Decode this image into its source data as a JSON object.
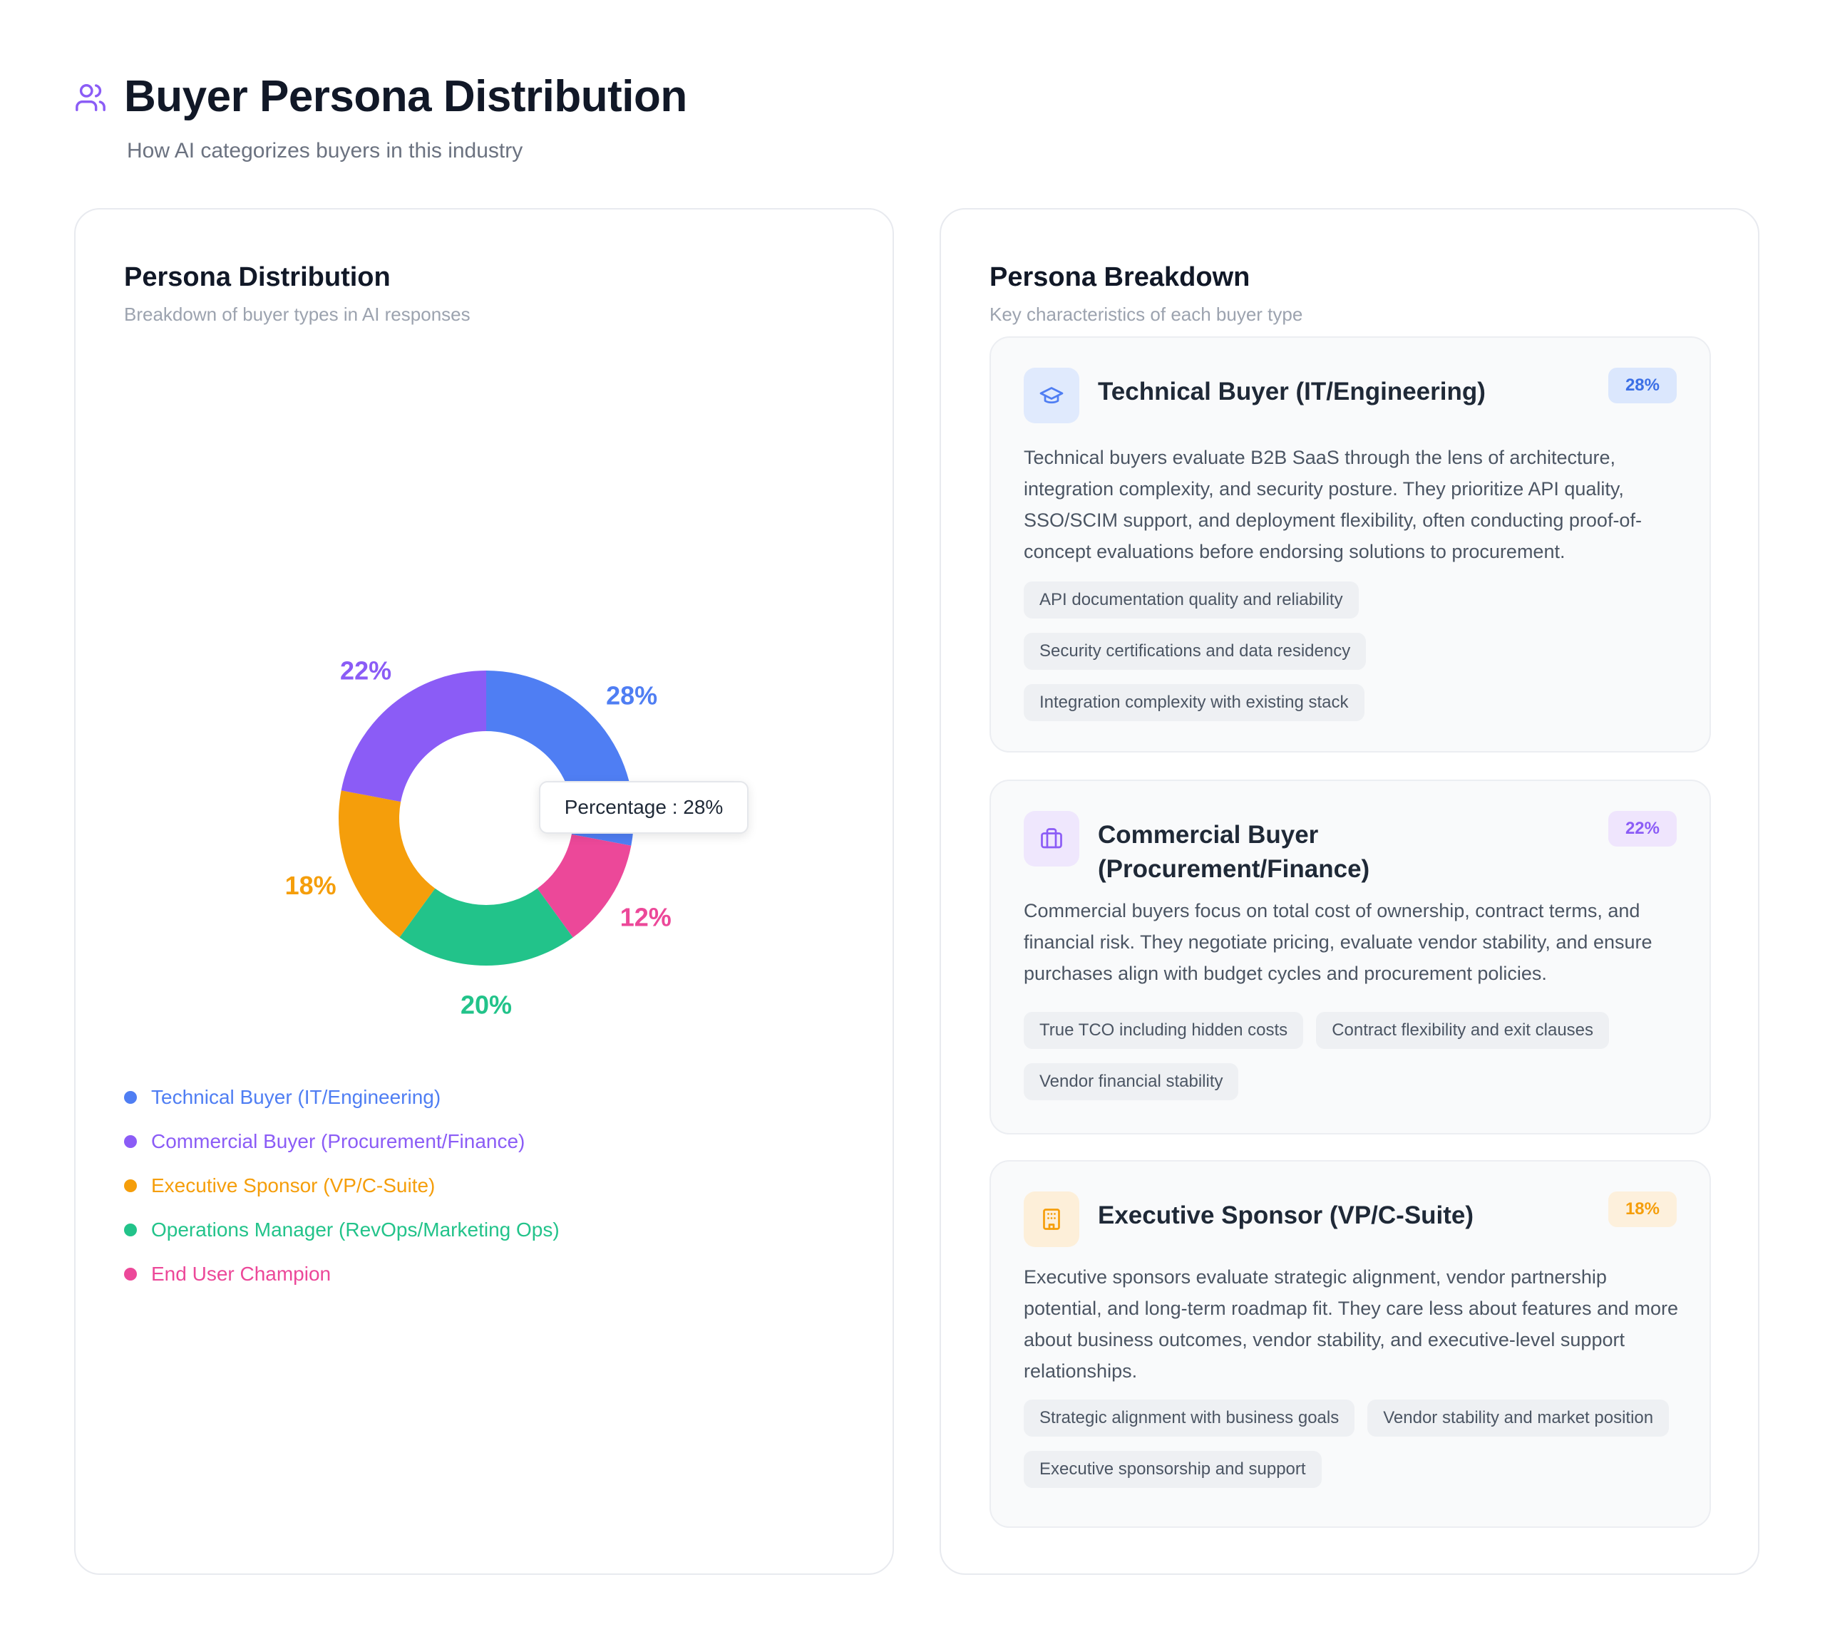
{
  "header": {
    "title": "Buyer Persona Distribution",
    "subtitle": "How AI categorizes buyers in this industry",
    "icon": "users-icon"
  },
  "left_card": {
    "title": "Persona Distribution",
    "subtitle": "Breakdown of buyer types in AI responses",
    "tooltip": "Percentage : 28%"
  },
  "chart_data": {
    "type": "pie",
    "donut": true,
    "categories": [
      "Technical Buyer (IT/Engineering)",
      "End User Champion",
      "Operations Manager (RevOps/Marketing Ops)",
      "Executive Sponsor (VP/C-Suite)",
      "Commercial Buyer (Procurement/Finance)"
    ],
    "values": [
      28,
      12,
      20,
      18,
      22
    ],
    "data_labels": [
      "28%",
      "12%",
      "20%",
      "18%",
      "22%"
    ],
    "colors": [
      "#4f7ef3",
      "#ec4899",
      "#22c38a",
      "#f59e0b",
      "#8b5cf6"
    ],
    "legend_position": "bottom-left"
  },
  "legend": [
    {
      "label": "Technical Buyer (IT/Engineering)",
      "color": "#4f7ef3"
    },
    {
      "label": "Commercial Buyer (Procurement/Finance)",
      "color": "#8b5cf6"
    },
    {
      "label": "Executive Sponsor (VP/C-Suite)",
      "color": "#f59e0b"
    },
    {
      "label": "Operations Manager (RevOps/Marketing Ops)",
      "color": "#22c38a"
    },
    {
      "label": "End User Champion",
      "color": "#ec4899"
    }
  ],
  "right_card": {
    "title": "Persona Breakdown",
    "subtitle": "Key characteristics of each buyer type",
    "personas": [
      {
        "title": "Technical Buyer (IT/Engineering)",
        "badge": "28%",
        "icon": "graduation-cap-icon",
        "accent": "#4f7ef3",
        "description": "Technical buyers evaluate B2B SaaS through the lens of architecture, integration complexity, and security posture. They prioritize API quality, SSO/SCIM support, and deployment flexibility, often conducting proof-of-concept evaluations before endorsing solutions to procurement.",
        "tags": [
          "API documentation quality and reliability",
          "Security certifications and data residency",
          "Integration complexity with existing stack"
        ]
      },
      {
        "title": "Commercial Buyer (Procurement/Finance)",
        "badge": "22%",
        "icon": "briefcase-icon",
        "accent": "#8b5cf6",
        "description": "Commercial buyers focus on total cost of ownership, contract terms, and financial risk. They negotiate pricing, evaluate vendor stability, and ensure purchases align with budget cycles and procurement policies.",
        "tags": [
          "True TCO including hidden costs",
          "Contract flexibility and exit clauses",
          "Vendor financial stability"
        ]
      },
      {
        "title": "Executive Sponsor (VP/C-Suite)",
        "badge": "18%",
        "icon": "building-icon",
        "accent": "#f59e0b",
        "description": "Executive sponsors evaluate strategic alignment, vendor partnership potential, and long-term roadmap fit. They care less about features and more about business outcomes, vendor stability, and executive-level support relationships.",
        "tags": [
          "Strategic alignment with business goals",
          "Vendor stability and market position",
          "Executive sponsorship and support"
        ]
      }
    ]
  }
}
